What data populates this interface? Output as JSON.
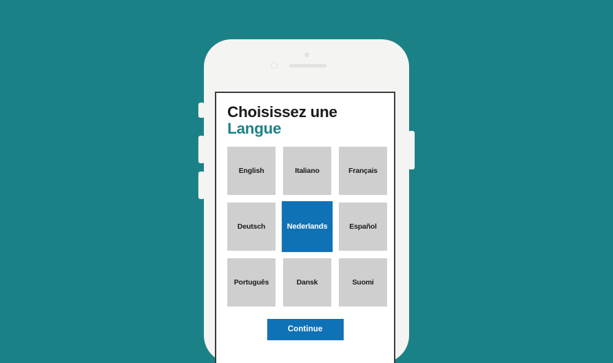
{
  "theme": {
    "background": "#1a8287",
    "accent_blue": "#0f72b5",
    "accent_teal": "#1c8287",
    "tile_gray": "#cfcfcf",
    "device_body": "#f4f4f2",
    "screen_background": "#ffffff",
    "text_dark": "#1a1a1a",
    "text_light": "#ffffff"
  },
  "device": {
    "type": "smartphone-mockup",
    "hardware": {
      "sensor": "proximity-sensor",
      "camera": "front-camera",
      "speaker": "earpiece-speaker",
      "mute_switch": "mute-switch",
      "volume_up": "volume-up-button",
      "volume_down": "volume-down-button",
      "power": "power-button"
    }
  },
  "screen": {
    "heading": {
      "line1": "Choisissez une",
      "line2": "Langue"
    },
    "language_grid": {
      "columns": 3,
      "rows": 3,
      "selected": "Nederlands",
      "tiles": [
        {
          "label": "English",
          "selected": false
        },
        {
          "label": "Italiano",
          "selected": false
        },
        {
          "label": "Français",
          "selected": false
        },
        {
          "label": "Deutsch",
          "selected": false
        },
        {
          "label": "Nederlands",
          "selected": true
        },
        {
          "label": "Español",
          "selected": false
        },
        {
          "label": "Português",
          "selected": false
        },
        {
          "label": "Dansk",
          "selected": false
        },
        {
          "label": "Suomi",
          "selected": false
        }
      ]
    },
    "continue_button": {
      "label": "Continue"
    }
  }
}
